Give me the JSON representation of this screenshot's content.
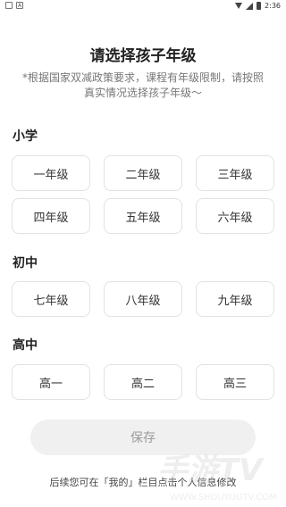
{
  "status_bar": {
    "left_icons": [
      "notification-icon",
      "a-app-icon"
    ],
    "a_label": "A",
    "time": "2:36"
  },
  "header": {
    "title": "请选择孩子年级",
    "subtitle": "*根据国家双减政策要求，课程有年级限制，请按照真实情况选择孩子年级～"
  },
  "sections": {
    "primary": {
      "label": "小学",
      "grades": [
        "一年级",
        "二年级",
        "三年级",
        "四年级",
        "五年级",
        "六年级"
      ]
    },
    "middle": {
      "label": "初中",
      "grades": [
        "七年级",
        "八年级",
        "九年级"
      ]
    },
    "high": {
      "label": "高中",
      "grades": [
        "高一",
        "高二",
        "高三"
      ]
    }
  },
  "save_label": "保存",
  "footer_note": "后续您可在「我的」栏目点击个人信息修改",
  "watermark": {
    "text": "手游TV",
    "url": "WWW.SHOUYOUTV.COM"
  },
  "colors": {
    "button_border": "#e2e2e2",
    "save_bg": "#f0f0f0",
    "save_text": "#9a9a9a"
  }
}
